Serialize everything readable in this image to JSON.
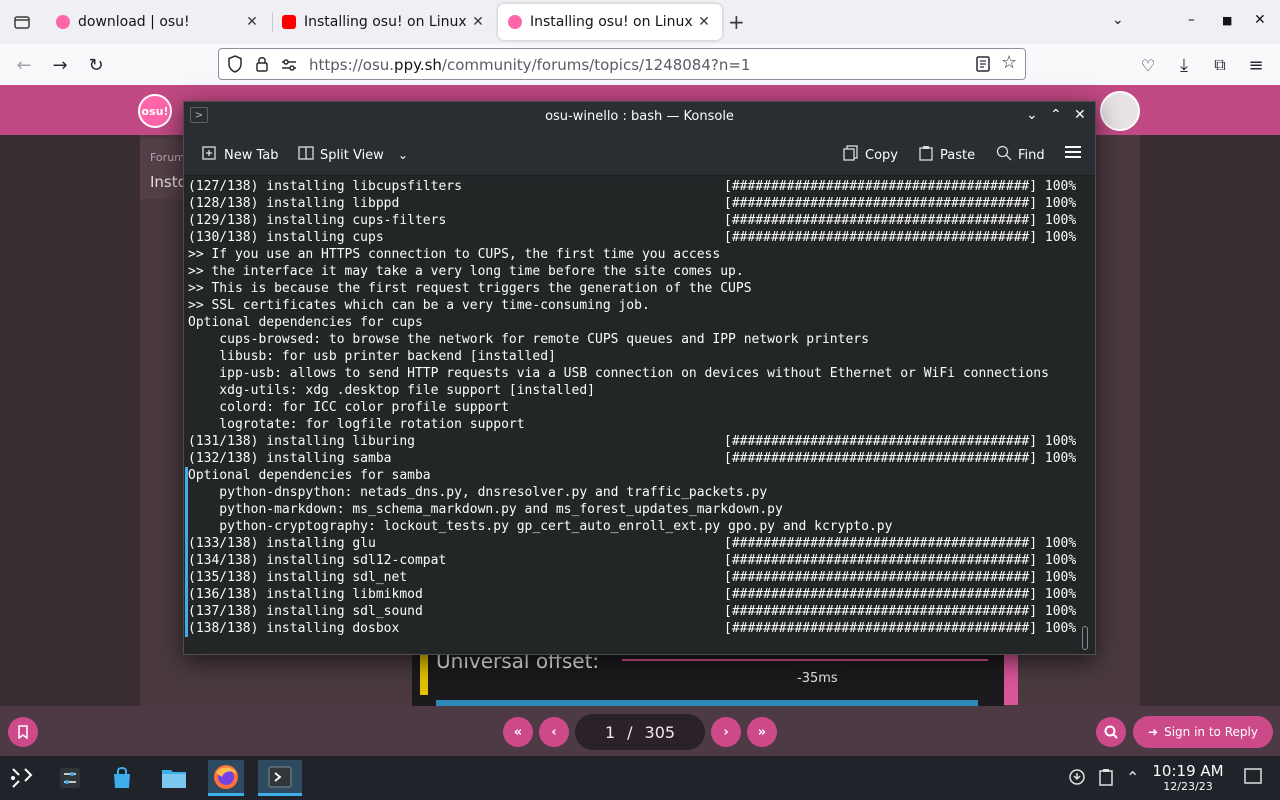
{
  "browser": {
    "tabs": [
      {
        "title": "download | osu!",
        "favicon_color": "#ff66aa",
        "active": false
      },
      {
        "title": "Installing osu! on Linux w",
        "favicon_color": "#ff0000",
        "active": false
      },
      {
        "title": "Installing osu! on Linux w",
        "favicon_color": "#ff66aa",
        "active": true
      }
    ],
    "new_tab_icon": "+",
    "url_domain_pre": "https://osu.",
    "url_domain_hl": "ppy.sh",
    "url_path": "/community/forums/topics/1248084?n=1"
  },
  "page": {
    "logo_text": "osu!",
    "forum_crumb": "Forum",
    "forum_title": "Insto",
    "post_image_label": "Universal offset:",
    "offset_value": "-35ms",
    "pagination": {
      "current": "1",
      "separator": "/",
      "total": "305"
    },
    "sign_in_label": "Sign in to Reply"
  },
  "konsole": {
    "title": "osu-winello : bash — Konsole",
    "toolbar": {
      "new_tab": "New Tab",
      "split_view": "Split View",
      "copy": "Copy",
      "paste": "Paste",
      "find": "Find"
    },
    "lines": [
      {
        "left": "(127/138) installing libcupsfilters",
        "right": "[######################################] 100%"
      },
      {
        "left": "(128/138) installing libppd",
        "right": "[######################################] 100%"
      },
      {
        "left": "(129/138) installing cups-filters",
        "right": "[######################################] 100%"
      },
      {
        "left": "(130/138) installing cups",
        "right": "[######################################] 100%"
      },
      {
        "left": ">> If you use an HTTPS connection to CUPS, the first time you access",
        "right": ""
      },
      {
        "left": ">> the interface it may take a very long time before the site comes up.",
        "right": ""
      },
      {
        "left": ">> This is because the first request triggers the generation of the CUPS",
        "right": ""
      },
      {
        "left": ">> SSL certificates which can be a very time-consuming job.",
        "right": ""
      },
      {
        "left": "Optional dependencies for cups",
        "right": ""
      },
      {
        "left": "    cups-browsed: to browse the network for remote CUPS queues and IPP network printers",
        "right": ""
      },
      {
        "left": "    libusb: for usb printer backend [installed]",
        "right": ""
      },
      {
        "left": "    ipp-usb: allows to send HTTP requests via a USB connection on devices without Ethernet or WiFi connections",
        "right": ""
      },
      {
        "left": "    xdg-utils: xdg .desktop file support [installed]",
        "right": ""
      },
      {
        "left": "    colord: for ICC color profile support",
        "right": ""
      },
      {
        "left": "    logrotate: for logfile rotation support",
        "right": ""
      },
      {
        "left": "(131/138) installing liburing",
        "right": "[######################################] 100%"
      },
      {
        "left": "(132/138) installing samba",
        "right": "[######################################] 100%"
      },
      {
        "left": "Optional dependencies for samba",
        "right": ""
      },
      {
        "left": "    python-dnspython: netads_dns.py, dnsresolver.py and traffic_packets.py",
        "right": ""
      },
      {
        "left": "    python-markdown: ms_schema_markdown.py and ms_forest_updates_markdown.py",
        "right": ""
      },
      {
        "left": "    python-cryptography: lockout_tests.py gp_cert_auto_enroll_ext.py gpo.py and kcrypto.py",
        "right": ""
      },
      {
        "left": "(133/138) installing glu",
        "right": "[######################################] 100%"
      },
      {
        "left": "(134/138) installing sdl12-compat",
        "right": "[######################################] 100%"
      },
      {
        "left": "(135/138) installing sdl_net",
        "right": "[######################################] 100%"
      },
      {
        "left": "(136/138) installing libmikmod",
        "right": "[######################################] 100%"
      },
      {
        "left": "(137/138) installing sdl_sound",
        "right": "[######################################] 100%"
      },
      {
        "left": "(138/138) installing dosbox",
        "right": "[######################################] 100%"
      }
    ]
  },
  "taskbar": {
    "time": "10:19 AM",
    "date": "12/23/23"
  },
  "colors": {
    "osu_pink": "#c14a84",
    "accent_blue": "#3daee9",
    "terminal_bg": "#232627"
  }
}
